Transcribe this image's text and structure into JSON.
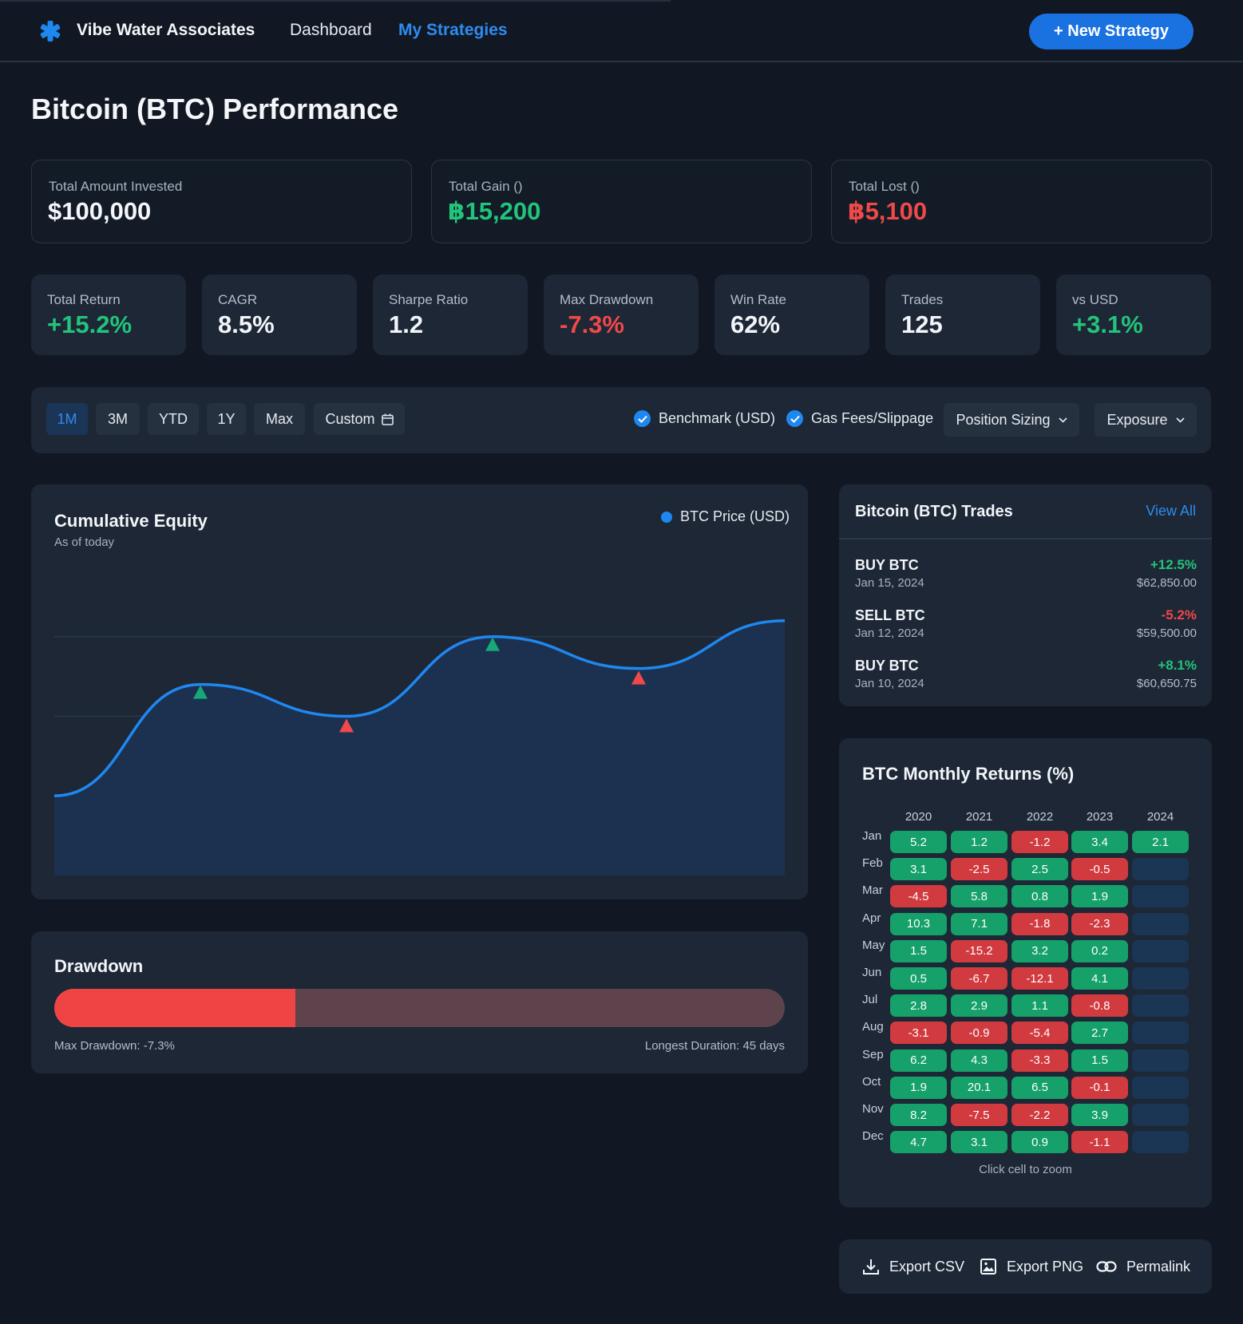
{
  "nav": {
    "brand": "Vibe Water Associates",
    "links": [
      "Dashboard",
      "My Strategies"
    ],
    "active": "My Strategies",
    "new_button": "+ New Strategy",
    "accent": "#1a72e0"
  },
  "page_title": "Bitcoin (BTC) Performance",
  "summary": [
    {
      "label": "Total Amount Invested",
      "value": "$100,000",
      "tone": "neutral"
    },
    {
      "label": "Total Gain ()",
      "value": "฿15,200",
      "tone": "positive"
    },
    {
      "label": "Total Lost ()",
      "value": "฿5,100",
      "tone": "negative"
    }
  ],
  "metrics": [
    {
      "label": "Total Return",
      "value": "+15.2%",
      "tone": "positive"
    },
    {
      "label": "CAGR",
      "value": "8.5%",
      "tone": "neutral"
    },
    {
      "label": "Sharpe Ratio",
      "value": "1.2",
      "tone": "neutral"
    },
    {
      "label": "Max Drawdown",
      "value": "-7.3%",
      "tone": "negative"
    },
    {
      "label": "Win Rate",
      "value": "62%",
      "tone": "neutral"
    },
    {
      "label": "Trades",
      "value": "125",
      "tone": "neutral"
    },
    {
      "label": "vs USD",
      "value": "+3.1%",
      "tone": "positive"
    }
  ],
  "toolbar": {
    "ranges": [
      "1M",
      "3M",
      "YTD",
      "1Y",
      "Max"
    ],
    "active_range": "1M",
    "custom_label": "Custom",
    "checkboxes": [
      {
        "label": "Benchmark (USD)",
        "checked": true
      },
      {
        "label": "Gas Fees/Slippage",
        "checked": true
      }
    ],
    "dropdowns": [
      "Position Sizing",
      "Exposure"
    ]
  },
  "equity": {
    "title": "Cumulative Equity",
    "subtitle": "As of today",
    "legend": "BTC Price (USD)",
    "line_color": "#1e88f0"
  },
  "chart_data": {
    "type": "area",
    "x": [
      0,
      1,
      2,
      3,
      4,
      5
    ],
    "values": [
      1.0,
      2.4,
      2.0,
      3.0,
      2.6,
      3.2
    ],
    "ylim": [
      0,
      4
    ],
    "grid": true,
    "legend": "top-right",
    "markers": [
      {
        "x": 1,
        "kind": "buy",
        "color": "#16a877"
      },
      {
        "x": 2,
        "kind": "sell",
        "color": "#ef4949"
      },
      {
        "x": 3,
        "kind": "buy",
        "color": "#16a877"
      },
      {
        "x": 4,
        "kind": "sell",
        "color": "#ef4949"
      }
    ]
  },
  "drawdown": {
    "title": "Drawdown",
    "fill_fraction": 0.33,
    "max_label": "Max Drawdown: -7.3%",
    "duration_label": "Longest Duration: 45 days"
  },
  "trades": {
    "title": "Bitcoin (BTC) Trades",
    "view_all": "View All",
    "rows": [
      {
        "side": "BUY BTC",
        "date": "Jan 15, 2024",
        "pct": "+12.5%",
        "price": "$62,850.00",
        "tone": "positive"
      },
      {
        "side": "SELL BTC",
        "date": "Jan 12, 2024",
        "pct": "-5.2%",
        "price": "$59,500.00",
        "tone": "negative"
      },
      {
        "side": "BUY BTC",
        "date": "Jan 10, 2024",
        "pct": "+8.1%",
        "price": "$60,650.75",
        "tone": "positive"
      }
    ]
  },
  "monthly": {
    "title": "BTC Monthly Returns (%)",
    "years": [
      "2020",
      "2021",
      "2022",
      "2023",
      "2024"
    ],
    "months": [
      "Jan",
      "Feb",
      "Mar",
      "Apr",
      "May",
      "Jun",
      "Jul",
      "Aug",
      "Sep",
      "Oct",
      "Nov",
      "Dec"
    ],
    "values": [
      [
        "5.2",
        "1.2",
        "-1.2",
        "3.4",
        "2.1"
      ],
      [
        "3.1",
        "-2.5",
        "2.5",
        "-0.5",
        ""
      ],
      [
        "-4.5",
        "5.8",
        "0.8",
        "1.9",
        ""
      ],
      [
        "10.3",
        "7.1",
        "-1.8",
        "-2.3",
        ""
      ],
      [
        "1.5",
        "-15.2",
        "3.2",
        "0.2",
        ""
      ],
      [
        "0.5",
        "-6.7",
        "-12.1",
        "4.1",
        ""
      ],
      [
        "2.8",
        "2.9",
        "1.1",
        "-0.8",
        ""
      ],
      [
        "-3.1",
        "-0.9",
        "-5.4",
        "2.7",
        ""
      ],
      [
        "6.2",
        "4.3",
        "-3.3",
        "1.5",
        ""
      ],
      [
        "1.9",
        "20.1",
        "6.5",
        "-0.1",
        ""
      ],
      [
        "8.2",
        "-7.5",
        "-2.2",
        "3.9",
        ""
      ],
      [
        "4.7",
        "3.1",
        "0.9",
        "-1.1",
        ""
      ]
    ],
    "footer": "Click cell to zoom"
  },
  "export": [
    {
      "label": "Export CSV",
      "icon": "download-icon"
    },
    {
      "label": "Export PNG",
      "icon": "image-icon"
    },
    {
      "label": "Permalink",
      "icon": "link-icon"
    }
  ]
}
